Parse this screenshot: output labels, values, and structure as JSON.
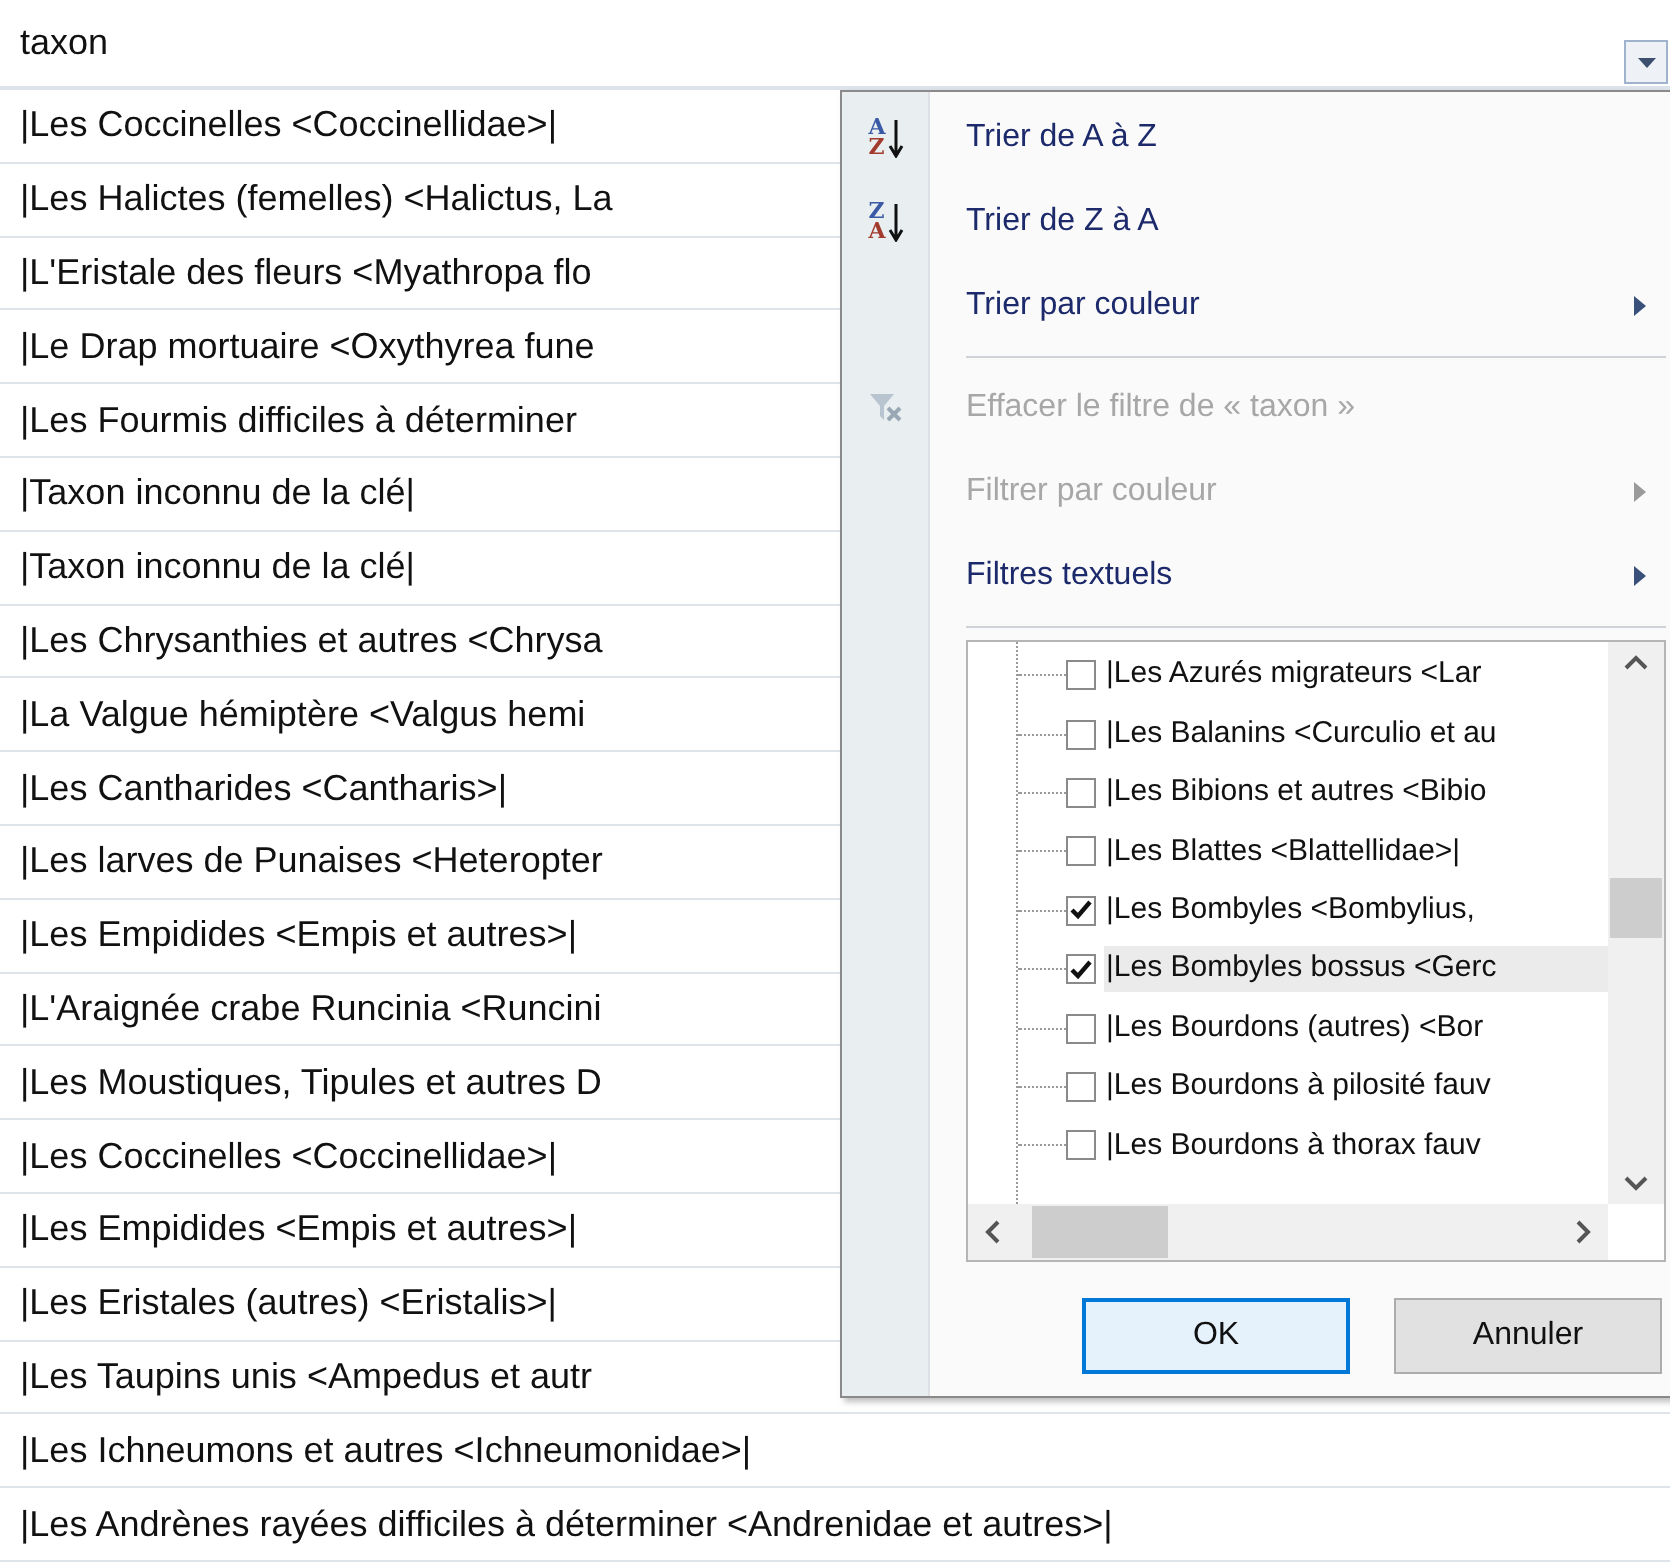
{
  "column": {
    "header": "taxon",
    "rows": [
      "|Les Coccinelles <Coccinellidae>|",
      "|Les Halictes (femelles) <Halictus, La",
      "|L'Eristale des fleurs <Myathropa flo",
      "|Le Drap mortuaire <Oxythyrea fune",
      "|Les Fourmis difficiles à déterminer",
      "|Taxon inconnu de la clé|",
      "|Taxon inconnu de la clé|",
      "|Les Chrysanthies et autres <Chrysa",
      "|La Valgue hémiptère <Valgus hemi",
      "|Les Cantharides <Cantharis>|",
      "|Les larves de Punaises <Heteropter",
      "|Les Empidides <Empis et autres>|",
      "|L'Araignée crabe Runcinia <Runcini",
      "|Les Moustiques, Tipules et autres D",
      "|Les Coccinelles <Coccinellidae>|",
      "|Les Empidides <Empis et autres>|",
      "|Les Eristales (autres) <Eristalis>|",
      "|Les Taupins unis <Ampedus et autr",
      "|Les Ichneumons et autres <Ichneumonidae>|",
      "|Les Andrènes rayées difficiles à déterminer <Andrenidae et autres>|"
    ]
  },
  "filter_menu": {
    "items": [
      {
        "kind": "sort",
        "label": "Trier de A à Z",
        "icon_letters": [
          "A",
          "Z"
        ],
        "disabled": false,
        "submenu": false
      },
      {
        "kind": "sort",
        "label": "Trier de Z à A",
        "icon_letters": [
          "Z",
          "A"
        ],
        "disabled": false,
        "submenu": false
      },
      {
        "kind": "plain",
        "label": "Trier par couleur",
        "disabled": false,
        "submenu": true
      },
      {
        "kind": "separator"
      },
      {
        "kind": "clear_filter",
        "label": "Effacer le filtre de « taxon »",
        "disabled": true,
        "submenu": false
      },
      {
        "kind": "plain",
        "label": "Filtrer par couleur",
        "disabled": true,
        "submenu": true
      },
      {
        "kind": "plain",
        "label": "Filtres textuels",
        "disabled": false,
        "submenu": true
      },
      {
        "kind": "separator"
      }
    ],
    "values": [
      {
        "label": "|Les Azurés migrateurs <Lar",
        "checked": false,
        "selected": false
      },
      {
        "label": "|Les Balanins <Curculio et au",
        "checked": false,
        "selected": false
      },
      {
        "label": "|Les Bibions et autres <Bibio",
        "checked": false,
        "selected": false
      },
      {
        "label": "|Les Blattes <Blattellidae>|",
        "checked": false,
        "selected": false
      },
      {
        "label": "|Les Bombyles <Bombylius, ",
        "checked": true,
        "selected": false
      },
      {
        "label": "|Les Bombyles bossus <Gerc",
        "checked": true,
        "selected": true
      },
      {
        "label": "|Les Bourdons (autres) <Bor",
        "checked": false,
        "selected": false
      },
      {
        "label": "|Les Bourdons à pilosité fauv",
        "checked": false,
        "selected": false
      },
      {
        "label": "|Les Bourdons à thorax fauv",
        "checked": false,
        "selected": false
      }
    ],
    "buttons": [
      {
        "label": "OK",
        "default": true
      },
      {
        "label": "Annuler",
        "default": false
      }
    ]
  }
}
